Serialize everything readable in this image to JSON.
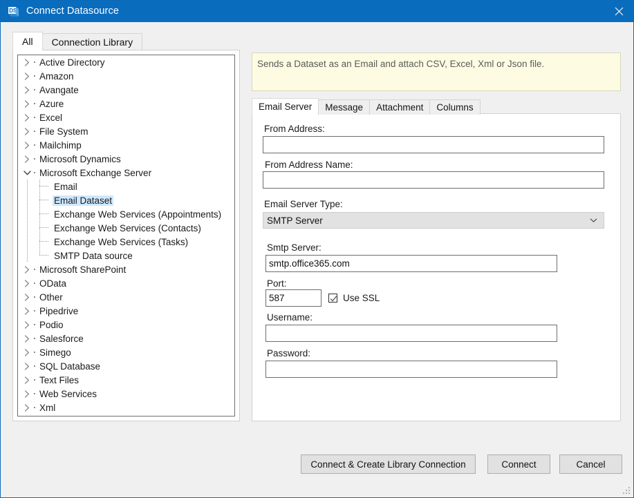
{
  "window": {
    "title": "Connect Datasource",
    "icon": "datasource-logo-icon",
    "close_label": "×"
  },
  "outer_tabs": [
    {
      "label": "All",
      "active": true
    },
    {
      "label": "Connection Library",
      "active": false
    }
  ],
  "tree": {
    "nodes": [
      {
        "label": "Active Directory",
        "level": 0,
        "state": "collapsed"
      },
      {
        "label": "Amazon",
        "level": 0,
        "state": "collapsed"
      },
      {
        "label": "Avangate",
        "level": 0,
        "state": "collapsed"
      },
      {
        "label": "Azure",
        "level": 0,
        "state": "collapsed"
      },
      {
        "label": "Excel",
        "level": 0,
        "state": "collapsed"
      },
      {
        "label": "File System",
        "level": 0,
        "state": "collapsed"
      },
      {
        "label": "Mailchimp",
        "level": 0,
        "state": "collapsed"
      },
      {
        "label": "Microsoft Dynamics",
        "level": 0,
        "state": "collapsed"
      },
      {
        "label": "Microsoft Exchange Server",
        "level": 0,
        "state": "expanded"
      },
      {
        "label": "Email",
        "level": 1,
        "state": "leaf"
      },
      {
        "label": "Email Dataset",
        "level": 1,
        "state": "leaf",
        "selected": true
      },
      {
        "label": "Exchange Web Services (Appointments)",
        "level": 1,
        "state": "leaf"
      },
      {
        "label": "Exchange Web Services (Contacts)",
        "level": 1,
        "state": "leaf"
      },
      {
        "label": "Exchange Web Services (Tasks)",
        "level": 1,
        "state": "leaf"
      },
      {
        "label": "SMTP Data source",
        "level": 1,
        "state": "leaf",
        "last": true
      },
      {
        "label": "Microsoft SharePoint",
        "level": 0,
        "state": "collapsed"
      },
      {
        "label": "OData",
        "level": 0,
        "state": "collapsed"
      },
      {
        "label": "Other",
        "level": 0,
        "state": "collapsed"
      },
      {
        "label": "Pipedrive",
        "level": 0,
        "state": "collapsed"
      },
      {
        "label": "Podio",
        "level": 0,
        "state": "collapsed"
      },
      {
        "label": "Salesforce",
        "level": 0,
        "state": "collapsed"
      },
      {
        "label": "Simego",
        "level": 0,
        "state": "collapsed"
      },
      {
        "label": "SQL Database",
        "level": 0,
        "state": "collapsed"
      },
      {
        "label": "Text Files",
        "level": 0,
        "state": "collapsed"
      },
      {
        "label": "Web Services",
        "level": 0,
        "state": "collapsed"
      },
      {
        "label": "Xml",
        "level": 0,
        "state": "collapsed"
      }
    ]
  },
  "description": "Sends a Dataset as an Email and attach CSV, Excel, Xml or Json file.",
  "inner_tabs": [
    {
      "label": "Email Server",
      "active": true
    },
    {
      "label": "Message",
      "active": false
    },
    {
      "label": "Attachment",
      "active": false
    },
    {
      "label": "Columns",
      "active": false
    }
  ],
  "form": {
    "from_address": {
      "label": "From Address:",
      "value": "",
      "placeholder": ""
    },
    "from_address_name": {
      "label": "From Address Name:",
      "value": "",
      "placeholder": ""
    },
    "email_server_type": {
      "label": "Email Server Type:",
      "value": "SMTP Server"
    },
    "smtp_server": {
      "label": "Smtp Server:",
      "value": "smtp.office365.com",
      "placeholder": ""
    },
    "port": {
      "label": "Port:",
      "value": "587",
      "placeholder": ""
    },
    "use_ssl": {
      "label": "Use SSL",
      "checked": true
    },
    "username": {
      "label": "Username:",
      "value": "",
      "placeholder": ""
    },
    "password": {
      "label": "Password:",
      "value": "",
      "placeholder": ""
    }
  },
  "footer": {
    "connect_create_label": "Connect & Create Library Connection",
    "connect_label": "Connect",
    "cancel_label": "Cancel"
  },
  "colors": {
    "titlebar": "#0a6cbd",
    "description_bg": "#fdfce2",
    "selection": "#cde8ff",
    "dialog_bg": "#f0f0f0",
    "button_bg": "#e1e1e1"
  }
}
